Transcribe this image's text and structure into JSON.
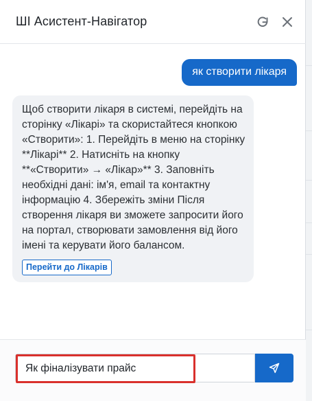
{
  "header": {
    "title": "ШІ Асистент-Навігатор",
    "refresh_icon": "refresh-icon",
    "close_icon": "close-icon"
  },
  "messages": {
    "user_message": "як створити лікаря",
    "assistant_message": "Щоб створити лікаря в системі, перейдіть на сторінку «Лікарі» та скористайтеся кнопкою «Створити»: 1. Перейдіть в меню на сторінку **Лікарі** 2. Натисніть на кнопку **«Створити» → «Лікар»** 3. Заповніть необхідні дані: ім'я, email та контактну інформацію 4. Збережіть зміни Після створення лікаря ви зможете запросити його на портал, створювати замовлення від його імені та керувати його балансом.",
    "action_link": "Перейти до Лікарів"
  },
  "composer": {
    "input_value": "Як фіналізувати прайс",
    "send_icon": "send-icon"
  },
  "colors": {
    "accent": "#1669c9",
    "highlight": "#d9302c"
  }
}
